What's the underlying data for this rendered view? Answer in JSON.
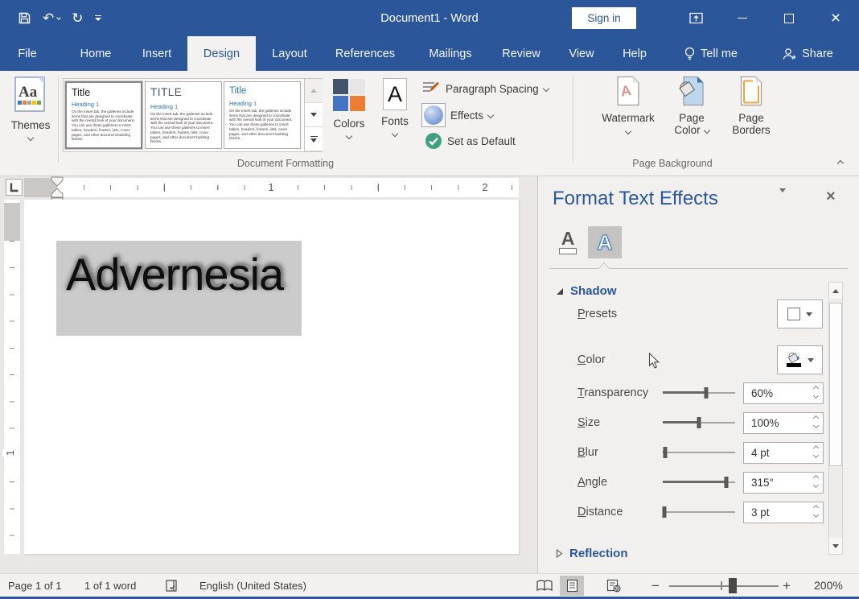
{
  "colors": {
    "accent": "#2B579A",
    "selection_highlight": "#CBCBCB",
    "theme_quadrants": [
      "#44546A",
      "#E7E6E6",
      "#4472C4",
      "#ED7D31"
    ]
  },
  "title_bar": {
    "title": "Document1 - Word",
    "sign_in_label": "Sign in",
    "quick_access_tools": [
      "save",
      "undo",
      "redo",
      "customize-quick-access-toolbar"
    ],
    "window_controls": [
      "ribbon-display-options",
      "minimize",
      "maximize",
      "close"
    ]
  },
  "tabs": [
    {
      "label": "File"
    },
    {
      "label": "Home"
    },
    {
      "label": "Insert"
    },
    {
      "label": "Design"
    },
    {
      "label": "Layout"
    },
    {
      "label": "References"
    },
    {
      "label": "Mailings"
    },
    {
      "label": "Review"
    },
    {
      "label": "View"
    },
    {
      "label": "Help"
    },
    {
      "label": "Tell me"
    },
    {
      "label": "Share"
    }
  ],
  "active_tab": "Design",
  "ribbon": {
    "themes": {
      "label": "Themes",
      "icon_text": "Aa"
    },
    "style_gallery": {
      "selected_index": 0,
      "items": [
        {
          "title": "Title",
          "heading": "Heading 1",
          "body": "On the Insert tab, the galleries include items that are designed to coordinate with the overall look of your document. You can use these galleries to insert tables, headers, footers, lists, cover pages, and other document building blocks."
        },
        {
          "title": "TITLE",
          "heading": "Heading 1",
          "body": "On the Insert tab, the galleries include items that are designed to coordinate with the overall look of your document. You can use these galleries to insert tables, headers, footers, lists, cover pages, and other document building blocks."
        },
        {
          "title": "Title",
          "heading": "Heading 1",
          "body": "On the Insert tab, the galleries include items that are designed to coordinate with the overall look of your document. You can use these galleries to insert tables, headers, footers, lists, cover pages, and other document building blocks."
        }
      ]
    },
    "colors_button": {
      "label": "Colors"
    },
    "fonts_button": {
      "label": "Fonts",
      "icon_text": "A"
    },
    "paragraph_spacing_button": {
      "label": "Paragraph Spacing"
    },
    "effects_button": {
      "label": "Effects"
    },
    "set_as_default_button": {
      "label": "Set as Default"
    },
    "watermark_button": {
      "label": "Watermark"
    },
    "page_color_button": {
      "label_line1": "Page",
      "label_line2": "Color"
    },
    "page_borders_button": {
      "label_line1": "Page",
      "label_line2": "Borders"
    },
    "groups": [
      {
        "label": "Document Formatting"
      },
      {
        "label": "Page Background"
      }
    ]
  },
  "ruler": {
    "h_numbers": [
      "1",
      "2"
    ],
    "v_numbers": [
      "1"
    ]
  },
  "document": {
    "text": "Advernesia",
    "selected": true
  },
  "panel": {
    "title": "Format Text Effects",
    "tabs": [
      {
        "name": "text-fill-and-outline",
        "icon_text": "A",
        "selected": false
      },
      {
        "name": "text-effects",
        "icon_text": "A",
        "selected": true
      }
    ],
    "shadow": {
      "label": "Shadow",
      "expanded": true,
      "presets": {
        "label": "Presets"
      },
      "color": {
        "label": "Color"
      },
      "sliders": [
        {
          "label": "Transparency",
          "value": "60%",
          "pct": 60
        },
        {
          "label": "Size",
          "value": "100%",
          "pct": 50
        },
        {
          "label": "Blur",
          "value": "4 pt",
          "pct": 3
        },
        {
          "label": "Angle",
          "value": "315°",
          "pct": 88
        },
        {
          "label": "Distance",
          "value": "3 pt",
          "pct": 2
        }
      ]
    },
    "reflection": {
      "label": "Reflection",
      "expanded": false
    }
  },
  "status_bar": {
    "page_indicator": "Page 1 of 1",
    "word_count": "1 of 1 word",
    "language": "English (United States)",
    "views": [
      "read-mode",
      "print-layout",
      "web-layout"
    ],
    "active_view": "print-layout",
    "zoom_level": "200%",
    "zoom_slider_pct": 58
  }
}
